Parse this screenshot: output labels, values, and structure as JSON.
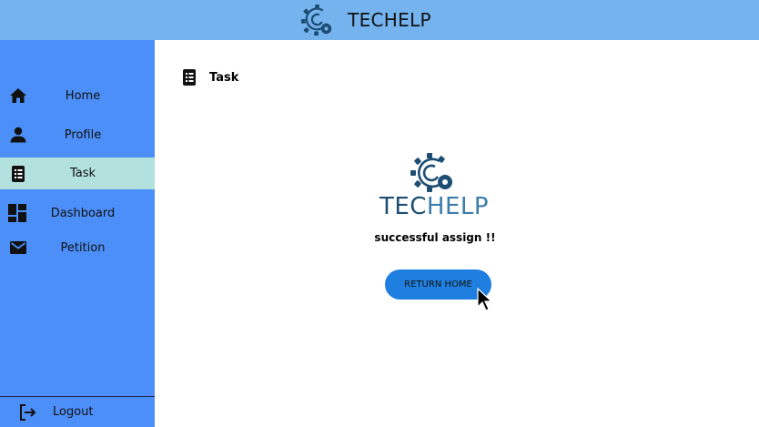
{
  "header": {
    "title": "TECHELP",
    "logo_icon": "gear-logo-icon"
  },
  "sidebar": {
    "items": [
      {
        "label": "Home",
        "icon": "home-icon"
      },
      {
        "label": "Profile",
        "icon": "person-icon"
      },
      {
        "label": "Task",
        "icon": "task-list-icon",
        "active": true
      },
      {
        "label": "Dashboard",
        "icon": "dashboard-icon"
      },
      {
        "label": "Petition",
        "icon": "mail-icon"
      }
    ],
    "logout": {
      "label": "Logout",
      "icon": "logout-icon"
    }
  },
  "main": {
    "page_title": "Task",
    "brand": {
      "dark": "TEC",
      "light": "HELP"
    },
    "message": "successful assign !!",
    "return_button": "RETURN HOME"
  },
  "colors": {
    "topbar": "#75b3ef",
    "sidebar": "#4d8ff8",
    "sidebar_active": "#b2e1de",
    "button": "#1f7fe0",
    "brand": "#1d4d72"
  }
}
